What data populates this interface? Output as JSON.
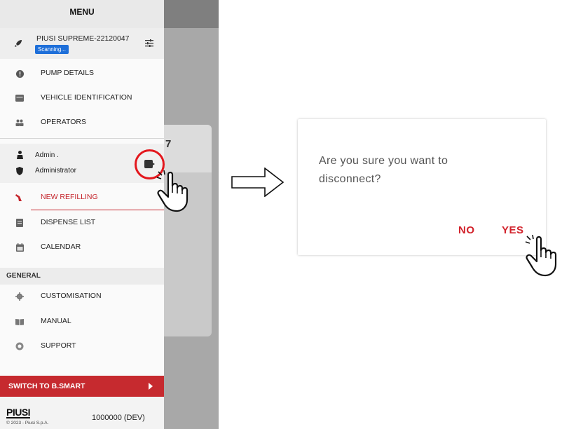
{
  "menu": {
    "title": "MENU",
    "device": {
      "name": "PIUSI SUPREME-22120047",
      "status": "Scanning..."
    },
    "items_top": [
      {
        "label": "PUMP DETAILS",
        "icon": "info-icon"
      },
      {
        "label": "VEHICLE IDENTIFICATION",
        "icon": "card-icon"
      },
      {
        "label": "OPERATORS",
        "icon": "people-icon"
      }
    ],
    "user": {
      "name": "Admin .",
      "role": "Administrator"
    },
    "items_mid": [
      {
        "label": "NEW REFILLING",
        "icon": "fuel-nozzle-icon",
        "active": true
      },
      {
        "label": "DISPENSE LIST",
        "icon": "list-icon"
      },
      {
        "label": "CALENDAR",
        "icon": "calendar-icon"
      }
    ],
    "general_heading": "GENERAL",
    "items_general": [
      {
        "label": "CUSTOMISATION",
        "icon": "gear-icon"
      },
      {
        "label": "MANUAL",
        "icon": "book-icon"
      },
      {
        "label": "SUPPORT",
        "icon": "lifebuoy-icon"
      }
    ],
    "switch_label": "SWITCH TO B.SMART",
    "footer": {
      "logo": "PIUSI",
      "copyright": "© 2023 - Piusi S.p.A.",
      "version": "1000000 (DEV)"
    }
  },
  "background": {
    "card_number": "7"
  },
  "dialog": {
    "message": "Are you sure you want to disconnect?",
    "no_label": "NO",
    "yes_label": "YES"
  },
  "colors": {
    "accent_red": "#c62a2f",
    "badge_blue": "#1e6fd9",
    "highlight_circle": "#e3171d"
  }
}
